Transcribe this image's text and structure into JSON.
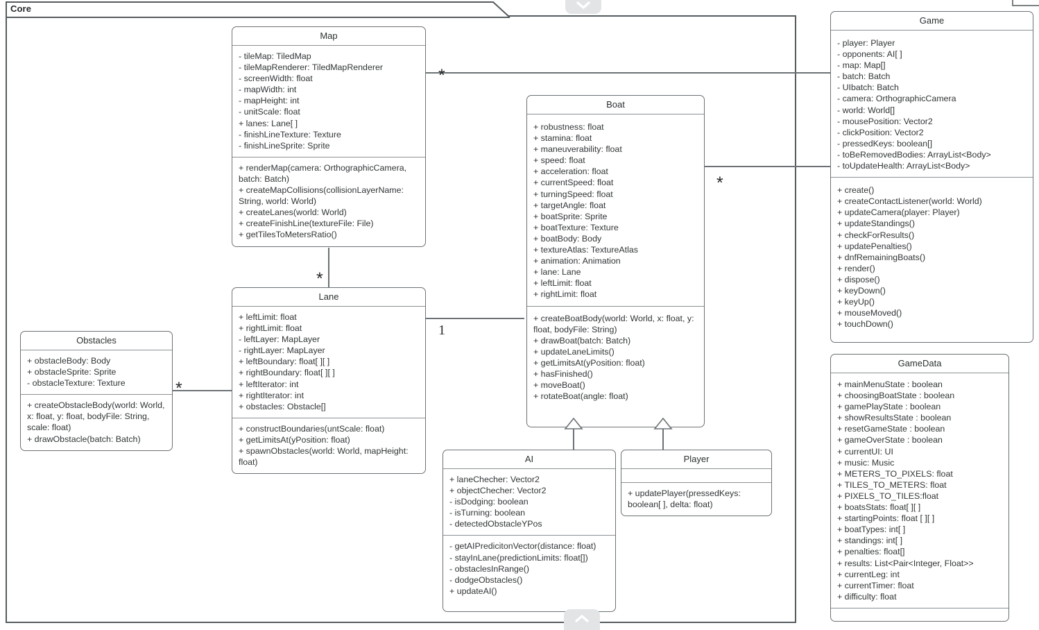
{
  "diagram": {
    "package_label": "Core",
    "handles": {
      "top_icon": "chevron-down-icon",
      "bottom_icon": "chevron-up-icon"
    }
  },
  "classes": {
    "map": {
      "name": "Map",
      "attributes": [
        "- tileMap: TiledMap",
        "- tileMapRenderer: TiledMapRenderer",
        "- screenWidth: float",
        "- mapWidth: int",
        "- mapHeight: int",
        "- unitScale: float",
        "+ lanes: Lane[ ]",
        "- finishLineTexture: Texture",
        "- finishLineSprite: Sprite"
      ],
      "methods": [
        "+ renderMap(camera: OrthographicCamera, batch: Batch)",
        "+ createMapCollisions(collisionLayerName: String, world: World)",
        "+ createLanes(world: World)",
        "+ createFinishLine(textureFile: File)",
        "+ getTilesToMetersRatio()"
      ]
    },
    "lane": {
      "name": "Lane",
      "attributes": [
        "+ leftLimit: float",
        "+ rightLimit: float",
        "- leftLayer: MapLayer",
        "- rightLayer: MapLayer",
        "+ leftBoundary: float[ ][ ]",
        "+ rightBoundary: float[ ][ ]",
        "+ leftIterator: int",
        "+ rightIterator: int",
        "+ obstacles: Obstacle[]"
      ],
      "methods": [
        "+ constructBoundaries(untScale: float)",
        "+ getLimitsAt(yPosition: float)",
        "+ spawnObstacles(world: World, mapHeight: float)"
      ]
    },
    "obstacles": {
      "name": "Obstacles",
      "attributes": [
        "+ obstacleBody: Body",
        "+ obstacleSprite: Sprite",
        "- obstacleTexture: Texture"
      ],
      "methods": [
        "+ createObstacleBody(world: World, x: float, y: float, bodyFile: String, scale: float)",
        "+ drawObstacle(batch: Batch)"
      ]
    },
    "boat": {
      "name": "Boat",
      "attributes": [
        "+ robustness: float",
        "+ stamina: float",
        "+ maneuverability: float",
        "+ speed: float",
        "+ acceleration: float",
        "+ currentSpeed: float",
        "+ turningSpeed: float",
        "+ targetAngle: float",
        "+ boatSprite: Sprite",
        "+ boatTexture: Texture",
        "+ boatBody: Body",
        "+ textureAtlas: TextureAtlas",
        "+ animation: Animation",
        "+ lane: Lane",
        "+ leftLimit: float",
        "+ rightLimit: float"
      ],
      "methods": [
        "+ createBoatBody(world: World, x: float, y: float, bodyFile: String)",
        "+ drawBoat(batch: Batch)",
        "+ updateLaneLimits()",
        "+ getLimitsAt(yPosition: float)",
        "+ hasFinished()",
        "+ moveBoat()",
        "+ rotateBoat(angle: float)"
      ]
    },
    "ai": {
      "name": "AI",
      "attributes": [
        "+ laneChecher: Vector2",
        "+ objectChecher: Vector2",
        "- isDodging: boolean",
        "- isTurning: boolean",
        "- detectedObstacleYPos"
      ],
      "methods": [
        "- getAIPredicitonVector(distance: float)",
        "- stayInLane(predictionLimits: float[])",
        "- obstaclesInRange()",
        "- dodgeObstacles()",
        "+ updateAI()"
      ]
    },
    "player": {
      "name": "Player",
      "attributes": [],
      "methods": [
        "+ updatePlayer(pressedKeys: boolean[ ], delta: float)"
      ]
    },
    "game": {
      "name": "Game",
      "attributes": [
        "- player: Player",
        "- opponents: AI[ ]",
        "- map: Map[]",
        "- batch: Batch",
        "- UIbatch: Batch",
        "- camera: OrthographicCamera",
        "- world: World[]",
        "- mousePosition: Vector2",
        "- clickPosition: Vector2",
        "- pressedKeys: boolean[]",
        "- toBeRemovedBodies: ArrayList<Body>",
        "- toUpdateHealth: ArrayList<Body>"
      ],
      "methods": [
        "+ create()",
        "+ createContactListener(world: World)",
        "+ updateCamera(player: Player)",
        "+ updateStandings()",
        "+ checkForResults()",
        "+ updatePenalties()",
        "+ dnfRemainingBoats()",
        "+ render()",
        "+ dispose()",
        "+ keyDown()",
        "+ keyUp()",
        "+ mouseMoved()",
        "+ touchDown()"
      ]
    },
    "gamedata": {
      "name": "GameData",
      "attributes": [
        "+ mainMenuState : boolean",
        "+ choosingBoatState : boolean",
        "+ gamePlayState : boolean",
        "+ showResultsState : boolean",
        "+ resetGameState : boolean",
        "+ gameOverState : boolean",
        "+ currentUI: UI",
        "+ music: Music",
        "+ METERS_TO_PIXELS: float",
        "+ TILES_TO_METERS: float",
        "+ PIXELS_TO_TILES:float",
        "+ boatsStats: float[ ][ ]",
        "+ startingPoints: float [ ][ ]",
        "+ boatTypes: int[ ]",
        "+ standings: int[ ]",
        "+ penalties: float[]",
        "+ results: List<Pair<Integer, Float>>",
        "+ currentLeg: int",
        "+ currentTimer: float",
        "+ difficulty: float"
      ],
      "methods": []
    }
  },
  "relationships": {
    "map_game": {
      "multiplicity": "*"
    },
    "boat_game": {
      "multiplicity": "*"
    },
    "map_lane": {
      "multiplicity": "*"
    },
    "lane_boat": {
      "multiplicity": "1"
    },
    "obstacles_lane": {
      "multiplicity": "*"
    }
  }
}
